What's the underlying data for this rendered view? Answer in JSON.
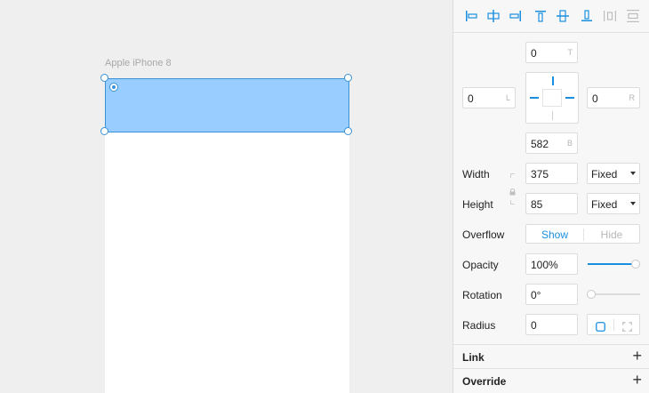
{
  "canvas": {
    "frame_label": "Apple iPhone 8",
    "selection_color": "#99ccff",
    "accent": "#1a8fdf"
  },
  "toolbar": {
    "tools": [
      {
        "name": "align-left-icon"
      },
      {
        "name": "align-center-horizontal-icon"
      },
      {
        "name": "align-right-icon"
      },
      {
        "name": "align-top-icon"
      },
      {
        "name": "align-middle-vertical-icon"
      },
      {
        "name": "align-bottom-icon"
      },
      {
        "name": "distribute-horizontal-icon"
      },
      {
        "name": "distribute-vertical-icon"
      }
    ]
  },
  "constraints": {
    "top": {
      "value": "0",
      "suffix": "T"
    },
    "left": {
      "value": "0",
      "suffix": "L"
    },
    "right": {
      "value": "0",
      "suffix": "R"
    },
    "bottom": {
      "value": "582",
      "suffix": "B"
    }
  },
  "size": {
    "width_label": "Width",
    "width_value": "375",
    "width_mode": "Fixed",
    "height_label": "Height",
    "height_value": "85",
    "height_mode": "Fixed"
  },
  "overflow": {
    "label": "Overflow",
    "show": "Show",
    "hide": "Hide",
    "selected": "Show"
  },
  "opacity": {
    "label": "Opacity",
    "value": "100%",
    "fraction": 1.0
  },
  "rotation": {
    "label": "Rotation",
    "value": "0°",
    "fraction": 0.0
  },
  "radius": {
    "label": "Radius",
    "value": "0"
  },
  "sections": {
    "link": "Link",
    "override": "Override",
    "add_symbol": "+"
  }
}
